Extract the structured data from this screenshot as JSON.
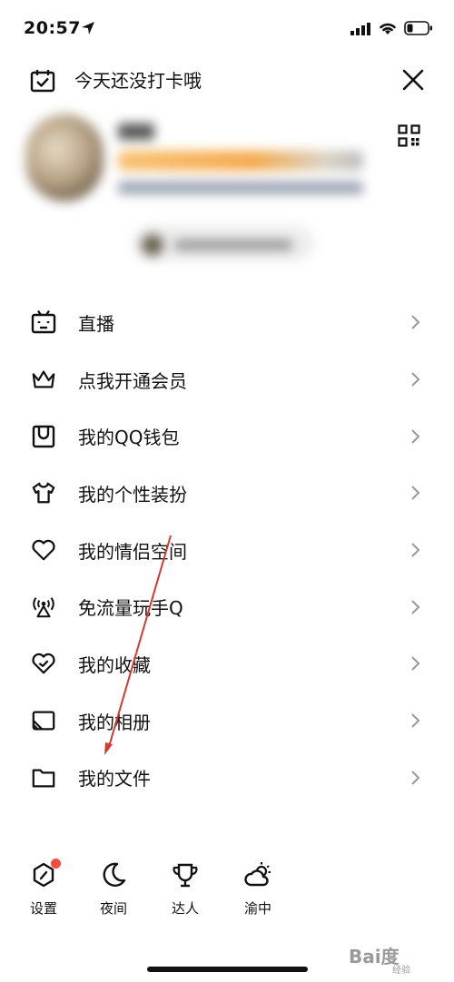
{
  "status_bar": {
    "time": "20:57",
    "icons": [
      "location-arrow-icon",
      "cellular-signal-icon",
      "wifi-icon",
      "battery-icon"
    ]
  },
  "header": {
    "checkin_label": "今天还没打卡哦",
    "checkin_icon": "calendar-check-icon",
    "close_icon": "close-icon"
  },
  "profile": {
    "qr_icon": "qr-code-icon"
  },
  "menu": {
    "items": [
      {
        "label": "直播",
        "icon": "live-tv-icon"
      },
      {
        "label": "点我开通会员",
        "icon": "crown-icon"
      },
      {
        "label": "我的QQ钱包",
        "icon": "wallet-icon"
      },
      {
        "label": "我的个性装扮",
        "icon": "shirt-icon"
      },
      {
        "label": "我的情侣空间",
        "icon": "heart-icon"
      },
      {
        "label": "免流量玩手Q",
        "icon": "antenna-icon"
      },
      {
        "label": "我的收藏",
        "icon": "favorites-icon"
      },
      {
        "label": "我的相册",
        "icon": "album-icon"
      },
      {
        "label": "我的文件",
        "icon": "folder-icon"
      }
    ]
  },
  "bottom_bar": {
    "items": [
      {
        "label": "设置",
        "icon": "settings-hexagon-icon"
      },
      {
        "label": "夜间",
        "icon": "moon-icon"
      },
      {
        "label": "达人",
        "icon": "trophy-icon"
      },
      {
        "label": "渝中",
        "icon": "weather-cloud-sun-icon"
      }
    ]
  },
  "watermark": {
    "text": "Bai度",
    "sub": "经验"
  },
  "colors": {
    "badge": "#f04f3f",
    "annotation_arrow": "#d23a32"
  }
}
